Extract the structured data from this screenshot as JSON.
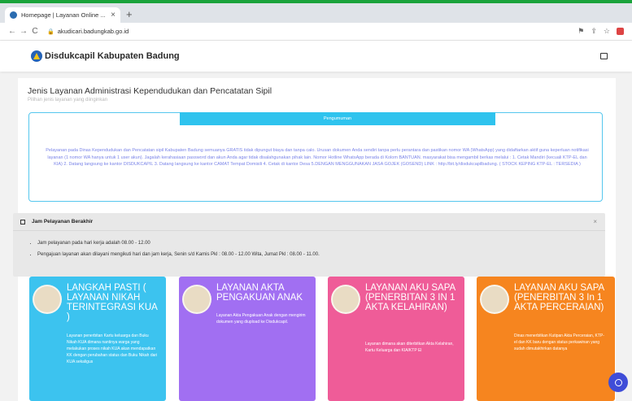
{
  "browser": {
    "tab_title": "Homepage | Layanan Online ...",
    "tab_close": "×",
    "new_tab": "+",
    "back": "←",
    "forward": "→",
    "reload": "C",
    "url": "akudicari.badungkab.go.id"
  },
  "site": {
    "brand": "Disdukcapil Kabupaten Badung"
  },
  "section": {
    "title": "Jenis Layanan Administrasi Kependudukan dan Pencatatan Sipil",
    "subtitle": "Pilihan jenis layanan yang diinginkan"
  },
  "announcement": {
    "header": "Pengumuman",
    "text": "Pelayanan pada Dinas Kependudukan dan Pencatatan sipil Kabupaten Badung semuanya GRATIS tidak dipungut biaya dan tanpa calo. Urusan dokumen Anda sendiri tanpa perlu perantara dan pastikan nomor WA (WhatsApp) yang didaftarkan aktif guna keperluan notifikasi layanan (1 nomor WA hanya untuk 1 user akun). Jagalah kerahasiaan password dan akun Anda agar tidak disalahgunakan pihak lain. Nomor Hotline WhatsApp berada di Kolom BANTUAN. masyarakat bisa mengambil berkas melalui : 1. Cetak Mandiri (kecuali KTP-EL dan KIA) 2. Datang langsung ke kantor DISDUKCAPIL 3. Datang langsung ke kantor CAMAT Tempat Domisili 4. Cetak di kantor Desa 5.DENGAN MENGGUNAKAN JASA GOJEK (GOSEND) LINK : http://bit.ly/disdukcapilbadung. ( STOCK KEPING KTP-EL : TERSEDIA )"
  },
  "alert": {
    "title": "Jam Pelayanan Berakhir",
    "close": "×",
    "items": [
      "Jam pelayanan pada hari kerja adalah 08.00 - 12.00",
      "Pengajuan layanan akan dilayani mengikuti hari dan jam kerja, Senin s/d Kamis Pkl : 08.00 - 12.00 Wita, Jumat Pkl : 08.00 - 11.00."
    ]
  },
  "cards": [
    {
      "title": "LANGKAH PASTI ( LAYANAN NIKAH TERINTEGRASI KUA )",
      "desc": "Layanan penerbitan Kartu keluarga dan Buku Nikah KUA dimana nantinya warga yang melakukan proses nikah KUA akan mendapatkan KK dengan perubahan status dan Buku Nikah dari KUA sekaligus",
      "color": "#3cc3ef"
    },
    {
      "title": "LAYANAN AKTA PENGAKUAN ANAK",
      "desc": "Layanan Akta Pengakuan Anak dengan mengirim dokumen yang diupload ke Disdukcapil.",
      "color": "#a16ff2"
    },
    {
      "title": "LAYANAN AKU SAPA (PENERBITAN 3 IN 1 AKTA KELAHIRAN)",
      "desc": "Layanan dimana akan diterbitkan Akta Kelahiran, Kartu Keluarga dan KIA/KTP El",
      "color": "#ef5c98"
    },
    {
      "title": "LAYANAN AKU SAPA (PENERBITAN 3 In 1 AKTA PERCERAIAN)",
      "desc": "Dinas menerbitkan Kutipan Akta Perceraian, KTP-el dan KK baru dengan status perkawinan yang sudah dimutakhirkan datanya",
      "color": "#f6851f"
    }
  ],
  "icons": {
    "favicon": "site-favicon",
    "lock": "lock-icon",
    "menu": "menu-toggle-icon",
    "chat": "chat-icon"
  }
}
